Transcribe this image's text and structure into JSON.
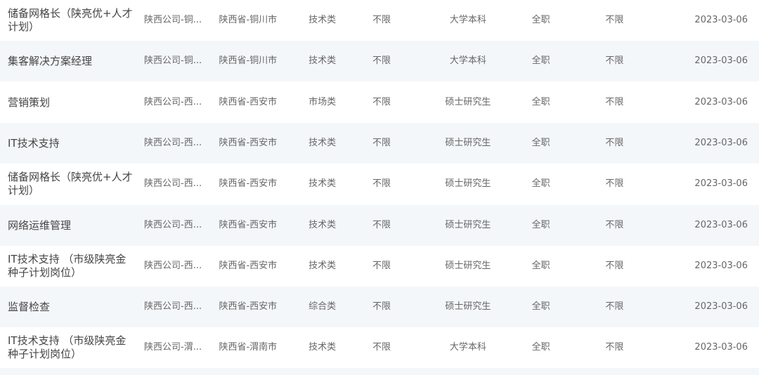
{
  "rows": [
    {
      "title": "储备网格长（陕亮优+人才计划）",
      "company": "陕西公司-铜...",
      "location": "陕西省-铜川市",
      "category": "技术类",
      "experience": "不限",
      "education": "大学本科",
      "job_type": "全职",
      "age": "不限",
      "date": "2023-03-06"
    },
    {
      "title": "集客解决方案经理",
      "company": "陕西公司-铜...",
      "location": "陕西省-铜川市",
      "category": "技术类",
      "experience": "不限",
      "education": "大学本科",
      "job_type": "全职",
      "age": "不限",
      "date": "2023-03-06"
    },
    {
      "title": "营销策划",
      "company": "陕西公司-西...",
      "location": "陕西省-西安市",
      "category": "市场类",
      "experience": "不限",
      "education": "硕士研究生",
      "job_type": "全职",
      "age": "不限",
      "date": "2023-03-06"
    },
    {
      "title": "IT技术支持",
      "company": "陕西公司-西...",
      "location": "陕西省-西安市",
      "category": "技术类",
      "experience": "不限",
      "education": "硕士研究生",
      "job_type": "全职",
      "age": "不限",
      "date": "2023-03-06"
    },
    {
      "title": "储备网格长（陕亮优+人才计划）",
      "company": "陕西公司-西...",
      "location": "陕西省-西安市",
      "category": "技术类",
      "experience": "不限",
      "education": "硕士研究生",
      "job_type": "全职",
      "age": "不限",
      "date": "2023-03-06"
    },
    {
      "title": "网络运维管理",
      "company": "陕西公司-西...",
      "location": "陕西省-西安市",
      "category": "技术类",
      "experience": "不限",
      "education": "硕士研究生",
      "job_type": "全职",
      "age": "不限",
      "date": "2023-03-06"
    },
    {
      "title": "IT技术支持 （市级陕亮金种子计划岗位）",
      "company": "陕西公司-西...",
      "location": "陕西省-西安市",
      "category": "技术类",
      "experience": "不限",
      "education": "硕士研究生",
      "job_type": "全职",
      "age": "不限",
      "date": "2023-03-06"
    },
    {
      "title": "监督检查",
      "company": "陕西公司-西...",
      "location": "陕西省-西安市",
      "category": "综合类",
      "experience": "不限",
      "education": "硕士研究生",
      "job_type": "全职",
      "age": "不限",
      "date": "2023-03-06"
    },
    {
      "title": "IT技术支持 （市级陕亮金种子计划岗位）",
      "company": "陕西公司-渭...",
      "location": "陕西省-渭南市",
      "category": "技术类",
      "experience": "不限",
      "education": "大学本科",
      "job_type": "全职",
      "age": "不限",
      "date": "2023-03-06"
    }
  ]
}
